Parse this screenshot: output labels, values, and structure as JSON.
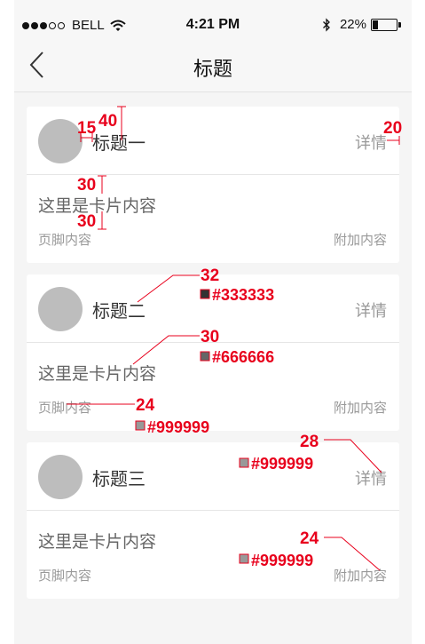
{
  "status_bar": {
    "carrier": "BELL",
    "time": "4:21 PM",
    "battery_percent": "22%",
    "battery_level": 0.22,
    "signal_bars_filled": 3,
    "signal_bars_total": 5
  },
  "nav": {
    "title": "标题"
  },
  "cards": [
    {
      "title": "标题一",
      "extra": "详情",
      "content": "这里是卡片内容",
      "footer_left": "页脚内容",
      "footer_right": "附加内容"
    },
    {
      "title": "标题二",
      "extra": "详情",
      "content": "这里是卡片内容",
      "footer_left": "页脚内容",
      "footer_right": "附加内容"
    },
    {
      "title": "标题三",
      "extra": "详情",
      "content": "这里是卡片内容",
      "footer_left": "页脚内容",
      "footer_right": "附加内容"
    }
  ],
  "annotations": {
    "spacing": [
      "15",
      "40",
      "20",
      "30",
      "30"
    ],
    "sizes": [
      "32",
      "30",
      "24",
      "28",
      "24"
    ],
    "colors": [
      "#333333",
      "#666666",
      "#999999",
      "#999999",
      "#999999"
    ]
  }
}
